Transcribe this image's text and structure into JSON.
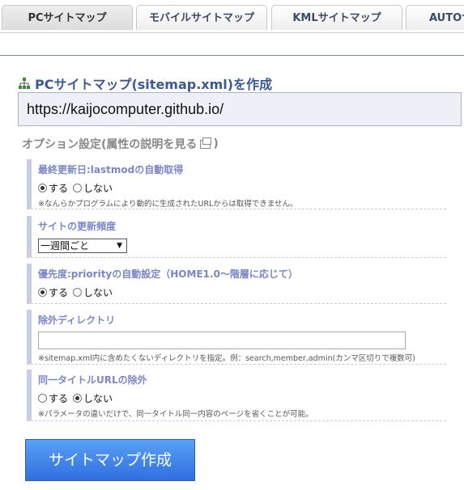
{
  "tabs": [
    {
      "label": "PCサイトマップ",
      "active": true
    },
    {
      "label": "モバイルサイトマップ",
      "active": false
    },
    {
      "label": "KMLサイトマップ",
      "active": false
    },
    {
      "label": "AUTOサ",
      "active": false
    }
  ],
  "heading": {
    "icon": "sitemap-icon",
    "text": "PCサイトマップ(sitemap.xml)を作成"
  },
  "url_input": {
    "value": "https://kaijocomputer.github.io/"
  },
  "options": {
    "title_prefix": "オプション設定(属性の説明を見る",
    "title_suffix": ")",
    "icon": "new-window-icon"
  },
  "sections": {
    "lastmod": {
      "title": "最終更新日:lastmodの自動取得",
      "yes": "する",
      "no": "しない",
      "selected": "yes",
      "note": "※なんらかプログラムにより動的に生成されたURLからは取得できません。"
    },
    "changefreq": {
      "title": "サイトの更新頻度",
      "selected": "一週間ごと"
    },
    "priority": {
      "title": "優先度:priorityの自動設定（HOME1.0～階層に応じて）",
      "yes": "する",
      "no": "しない",
      "selected": "yes"
    },
    "exclude_dir": {
      "title": "除外ディレクトリ",
      "value": "",
      "note": "※sitemap.xml内に含めたくないディレクトリを指定。例：search,member,admin(カンマ区切りで複数可)"
    },
    "same_title": {
      "title": "同一タイトルURLの除外",
      "yes": "する",
      "no": "しない",
      "selected": "no",
      "note": "※パラメータの違いだけで、同一タイトル同一内容のページを省くことが可能。"
    }
  },
  "submit_label": "サイトマップ作成",
  "colors": {
    "heading": "#3b5998",
    "section_title": "#7b86c9",
    "button": "#2f6fe0"
  }
}
